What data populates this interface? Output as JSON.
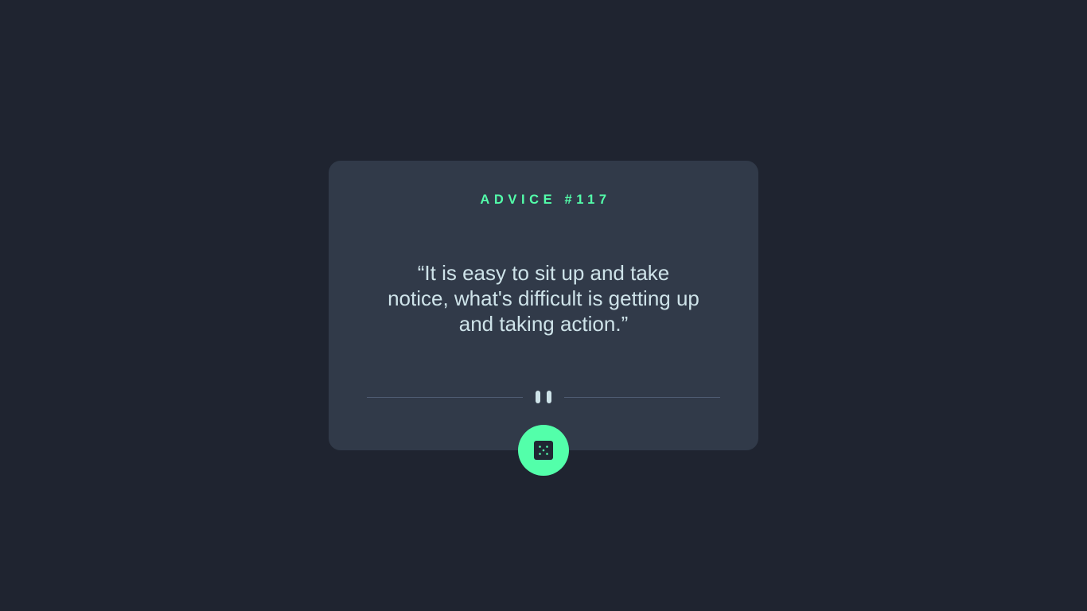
{
  "advice": {
    "label": "ADVICE #117",
    "quote": "“It is easy to sit up and take notice, what's difficult is getting up and taking action.”"
  },
  "divider": {
    "icon": "pause-icon"
  },
  "button": {
    "icon": "dice-icon"
  },
  "colors": {
    "background": "#1f2430",
    "card": "#313a49",
    "accent": "#53ffaa",
    "text": "#cee3e9",
    "divider": "#4f5d73"
  }
}
